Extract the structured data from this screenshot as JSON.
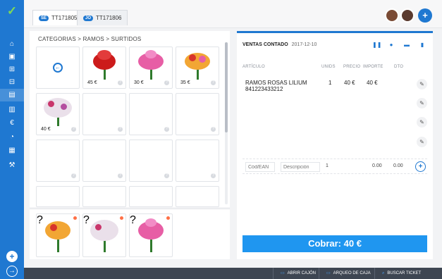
{
  "app": {
    "tabs": [
      {
        "badge": "SE",
        "label": "TT171805",
        "active": true
      },
      {
        "badge": "JO",
        "label": "TT171806",
        "active": false
      }
    ]
  },
  "rail": {
    "icons": [
      "home-icon",
      "user-icon",
      "cart-icon",
      "cart-icon",
      "document-icon",
      "stats-icon",
      "euro-icon",
      "pie-icon",
      "calendar-icon",
      "wrench-icon"
    ]
  },
  "catalog": {
    "breadcrumb": "CATEGORIAS > RAMOS > SURTIDOS",
    "tiles": [
      {
        "kind": "back"
      },
      {
        "kind": "product",
        "price": "45 €",
        "color": "#cc1b1b"
      },
      {
        "kind": "product",
        "price": "30 €",
        "color": "#e75ea5"
      },
      {
        "kind": "product",
        "price": "35 €",
        "color": "#f2a634"
      },
      {
        "kind": "product",
        "price": "40 €",
        "color": "#f4eef5"
      },
      {
        "kind": "empty"
      },
      {
        "kind": "empty"
      },
      {
        "kind": "empty"
      },
      {
        "kind": "empty"
      },
      {
        "kind": "empty"
      },
      {
        "kind": "empty"
      },
      {
        "kind": "empty"
      },
      {
        "kind": "empty"
      },
      {
        "kind": "empty"
      },
      {
        "kind": "empty"
      },
      {
        "kind": "empty"
      }
    ],
    "favorites": [
      {
        "color": "#f2a634"
      },
      {
        "color": "#f4eef5"
      },
      {
        "color": "#e75ea5"
      }
    ]
  },
  "ticket": {
    "title": "VENTAS CONTADO",
    "date": "2017-12-10",
    "columns": {
      "articulo": "ARTÍCULO",
      "unids": "UNIDS",
      "precio": "PRECIO",
      "importe": "IMPORTE",
      "dto": "DTO"
    },
    "lines": [
      {
        "desc": "RAMOS ROSAS LILIUM",
        "code": "841223433212",
        "unids": "1",
        "precio": "40 €",
        "importe": "40 €"
      }
    ],
    "entry": {
      "ean_placeholder": "Cód/EAN",
      "desc_placeholder": "Descripción",
      "qty": "1",
      "price": "0.00",
      "discount": "0.00"
    },
    "charge_label": "Cobrar: 40 €"
  },
  "bottombar": {
    "items": [
      "ABRIR CAJÓN",
      "ARQUEO DE CAJA",
      "BUSCAR TICKET"
    ]
  },
  "colors": {
    "brand": "#1f78d1",
    "charge": "#1f96f0",
    "logo": "#7ed957"
  }
}
